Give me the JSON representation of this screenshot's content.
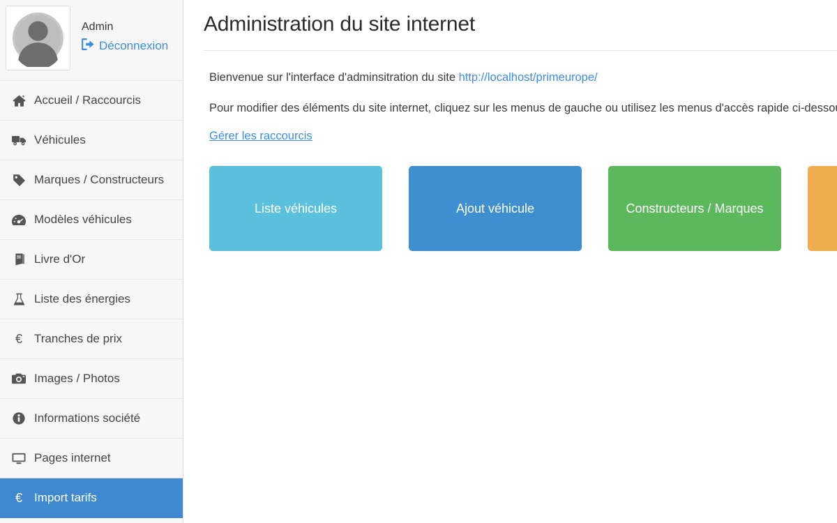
{
  "sidebar": {
    "user": {
      "name": "Admin",
      "avatar_icon": "user-avatar-icon",
      "logout_label": "Déconnexion",
      "logout_icon": "sign-out-icon"
    },
    "items": [
      {
        "label": "Accueil / Raccourcis",
        "icon": "home-icon",
        "active": false
      },
      {
        "label": "Véhicules",
        "icon": "truck-icon",
        "active": false
      },
      {
        "label": "Marques / Constructeurs",
        "icon": "tag-icon",
        "active": false
      },
      {
        "label": "Modèles véhicules",
        "icon": "gauge-icon",
        "active": false
      },
      {
        "label": "Livre d'Or",
        "icon": "book-icon",
        "active": false
      },
      {
        "label": "Liste des énergies",
        "icon": "flask-icon",
        "active": false
      },
      {
        "label": "Tranches de prix",
        "icon": "euro-icon",
        "active": false
      },
      {
        "label": "Images / Photos",
        "icon": "camera-icon",
        "active": false
      },
      {
        "label": "Informations société",
        "icon": "info-icon",
        "active": false
      },
      {
        "label": "Pages internet",
        "icon": "desktop-icon",
        "active": false
      },
      {
        "label": "Import tarifs",
        "icon": "euro-icon",
        "active": true
      }
    ]
  },
  "main": {
    "title": "Administration du site internet",
    "welcome_prefix": "Bienvenue sur l'interface d'adminsitration du site ",
    "site_url": "http://localhost/primeurope/",
    "instructions": "Pour modifier des éléments du site internet, cliquez sur les menus de gauche ou utilisez les menus d'accès rapide ci-dessous.",
    "manage_shortcuts_label": "Gérer les raccourcis",
    "tiles": [
      {
        "label": "Liste véhicules",
        "color": "#5bc0de"
      },
      {
        "label": "Ajout véhicule",
        "color": "#3e8ed0"
      },
      {
        "label": "Constructeurs / Marques",
        "color": "#5cb85c"
      },
      {
        "label": "",
        "color": "#f0ad4e"
      }
    ]
  },
  "colors": {
    "sidebar_bg": "#f7f7f7",
    "active_item": "#4189ce",
    "link": "#3c8dde"
  }
}
